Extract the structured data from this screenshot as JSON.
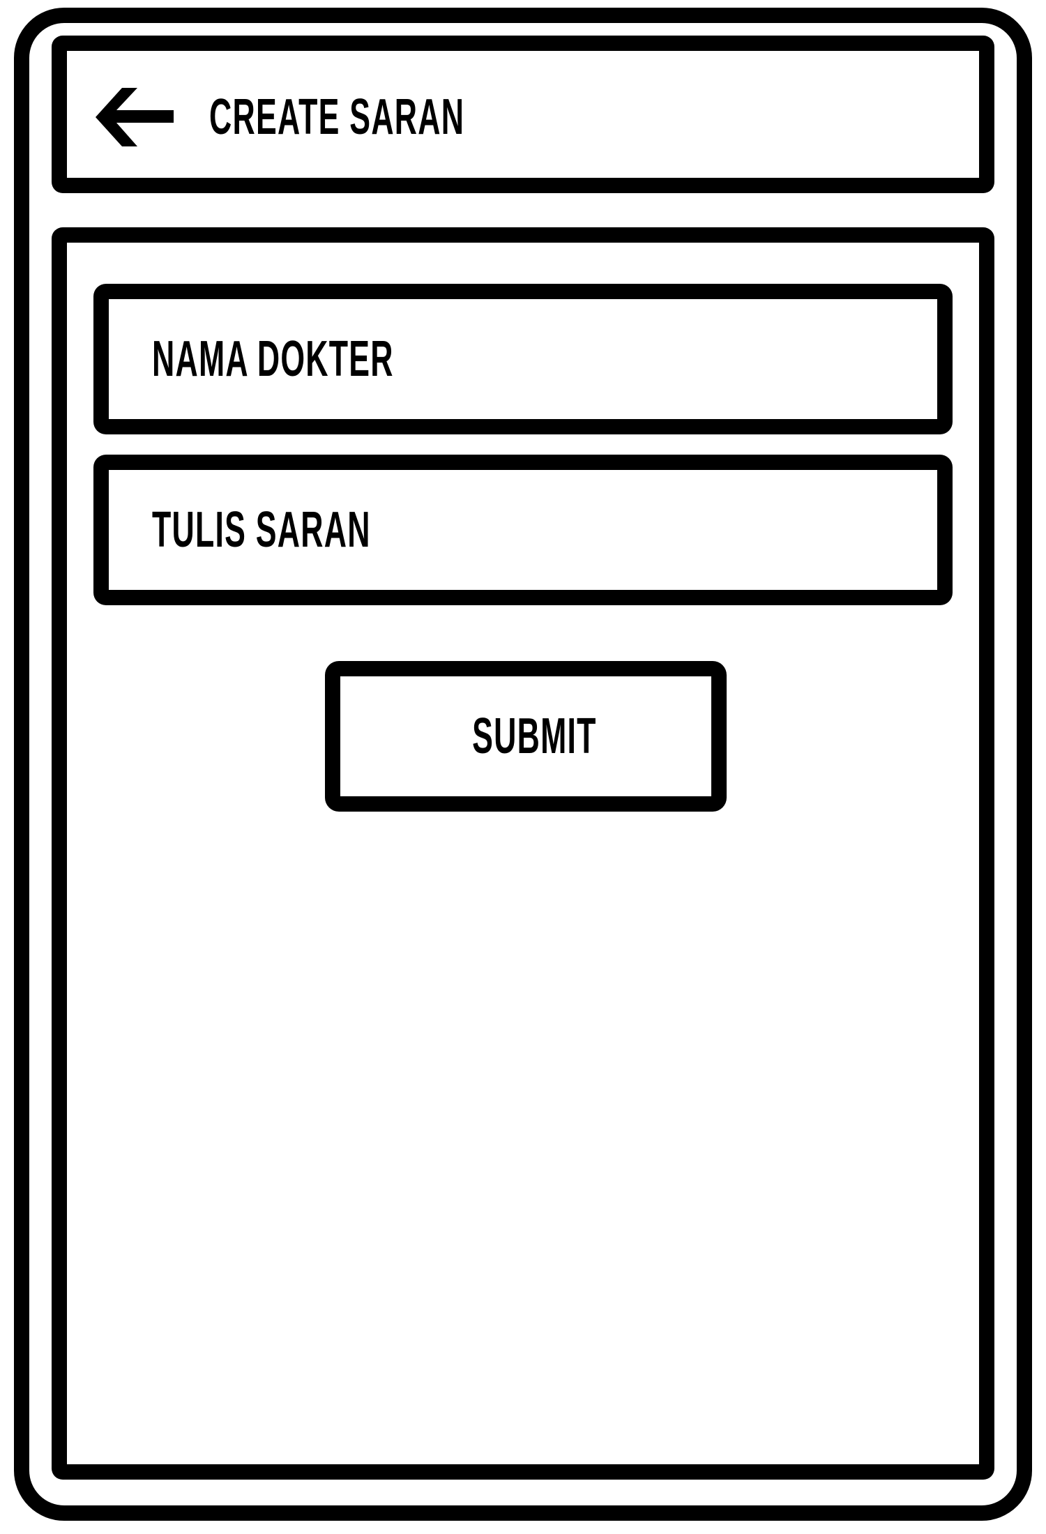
{
  "header": {
    "title": "CREATE SARAN",
    "back_icon": "arrow-left-icon"
  },
  "form": {
    "doctor_name_placeholder": "NAMA DOKTER",
    "saran_placeholder": "TULIS SARAN",
    "submit_label": "SUBMIT"
  },
  "colors": {
    "stroke": "#000000",
    "background": "#ffffff"
  }
}
